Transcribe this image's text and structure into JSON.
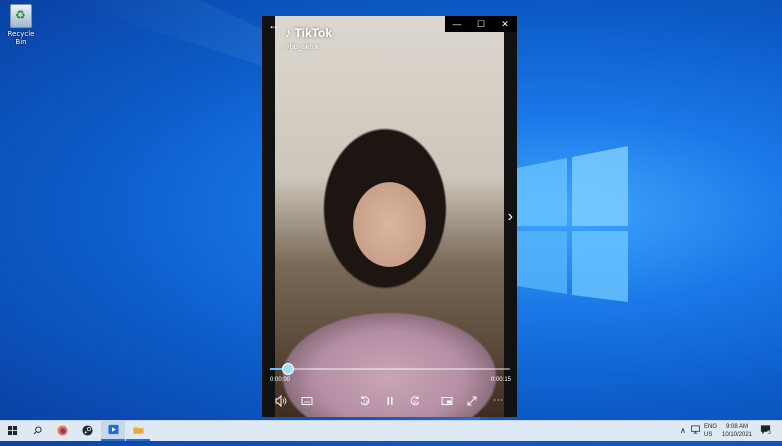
{
  "desktop": {
    "icons": [
      {
        "label": "Recycle Bin"
      }
    ]
  },
  "player": {
    "window_buttons": {
      "minimize": "—",
      "maximize": "☐",
      "close": "✕"
    },
    "back_glyph": "←",
    "overlay": {
      "brand": "TikTok",
      "handle": "@bp_tiktok"
    },
    "next_glyph": "›",
    "progress": {
      "current_time": "0:00:00",
      "duration": "0:00:15",
      "fraction": 0.07
    },
    "controls": {
      "volume": "volume-icon",
      "subtitles": "subtitles-icon",
      "skip_back_label": "10",
      "play_pause": "pause-icon",
      "skip_forward_label": "30",
      "miniplayer": "miniplayer-icon",
      "fullscreen": "fullscreen-icon",
      "more": "⋯"
    },
    "accent": "#5ec8ff"
  },
  "taskbar": {
    "apps": [
      {
        "name": "start-button",
        "glyph": "⊞"
      },
      {
        "name": "search-button",
        "glyph": "⌕"
      },
      {
        "name": "firefox-taskbar",
        "glyph": "●"
      },
      {
        "name": "steam-taskbar",
        "glyph": "⚙"
      },
      {
        "name": "movies-tv-taskbar",
        "glyph": "▶"
      },
      {
        "name": "file-explorer-taskbar",
        "glyph": "▬"
      }
    ],
    "tray": {
      "lang_primary": "ENG",
      "lang_secondary": "US",
      "time": "9:08 AM",
      "date": "10/10/2021",
      "notification_count": "3"
    }
  }
}
